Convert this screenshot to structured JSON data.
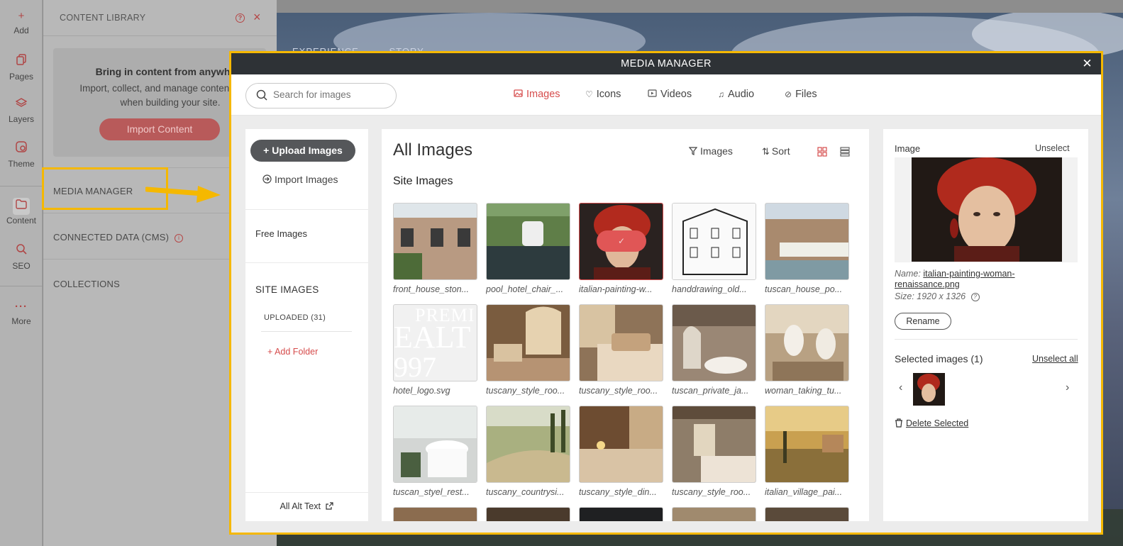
{
  "rail": {
    "items": [
      {
        "label": "Add",
        "icon": "plus-icon"
      },
      {
        "label": "Pages",
        "icon": "pages-icon"
      },
      {
        "label": "Layers",
        "icon": "layers-icon"
      },
      {
        "label": "Theme",
        "icon": "theme-icon"
      },
      {
        "label": "Content",
        "icon": "folder-icon"
      },
      {
        "label": "SEO",
        "icon": "seo-icon"
      },
      {
        "label": "More",
        "icon": "more-icon"
      }
    ]
  },
  "library": {
    "title": "CONTENT LIBRARY",
    "card_heading": "Bring in content from anywhere",
    "card_text": "Import, collect, and manage content to use when building your site.",
    "import_button": "Import Content",
    "media_manager": "MEDIA MANAGER",
    "connected_data": "CONNECTED DATA (CMS)",
    "collections": "COLLECTIONS"
  },
  "hero": {
    "nav": [
      "EXPERIENCE",
      "STORY"
    ]
  },
  "modal": {
    "title": "MEDIA MANAGER",
    "search_placeholder": "Search for images",
    "tabs": [
      "Images",
      "Icons",
      "Videos",
      "Audio",
      "Files"
    ],
    "active_tab": "Images",
    "left": {
      "upload_button": "Upload Images",
      "import_link": "Import Images",
      "free_images": "Free Images",
      "site_images_heading": "SITE IMAGES",
      "uploaded": "UPLOADED (31)",
      "add_folder": "Add Folder",
      "alt_text": "All Alt Text"
    },
    "center": {
      "heading": "All Images",
      "filter_label": "Images",
      "sort_label": "Sort",
      "section": "Site Images",
      "images": [
        "front_house_ston...",
        "pool_hotel_chair_...",
        "italian-painting-w...",
        "handdrawing_old...",
        "tuscan_house_po...",
        "hotel_logo.svg",
        "tuscany_style_roo...",
        "tuscany_style_roo...",
        "tuscan_private_ja...",
        "woman_taking_tu...",
        "tuscan_styel_rest...",
        "tuscany_countrysi...",
        "tuscany_style_din...",
        "tuscany_style_roo...",
        "italian_village_pai..."
      ],
      "selected_index": 2,
      "logo_text": [
        "PREMI",
        "EALT",
        "997"
      ],
      "accent_color": "#d64c4c"
    },
    "right": {
      "image_heading": "Image",
      "unselect": "Unselect",
      "name_label": "Name:",
      "name_value": "italian-painting-woman-renaissance.png",
      "size_label": "Size:",
      "size_value": "1920 x 1326",
      "rename": "Rename",
      "selected_heading": "Selected images (1)",
      "unselect_all": "Unselect all",
      "delete_selected": "Delete Selected"
    }
  }
}
